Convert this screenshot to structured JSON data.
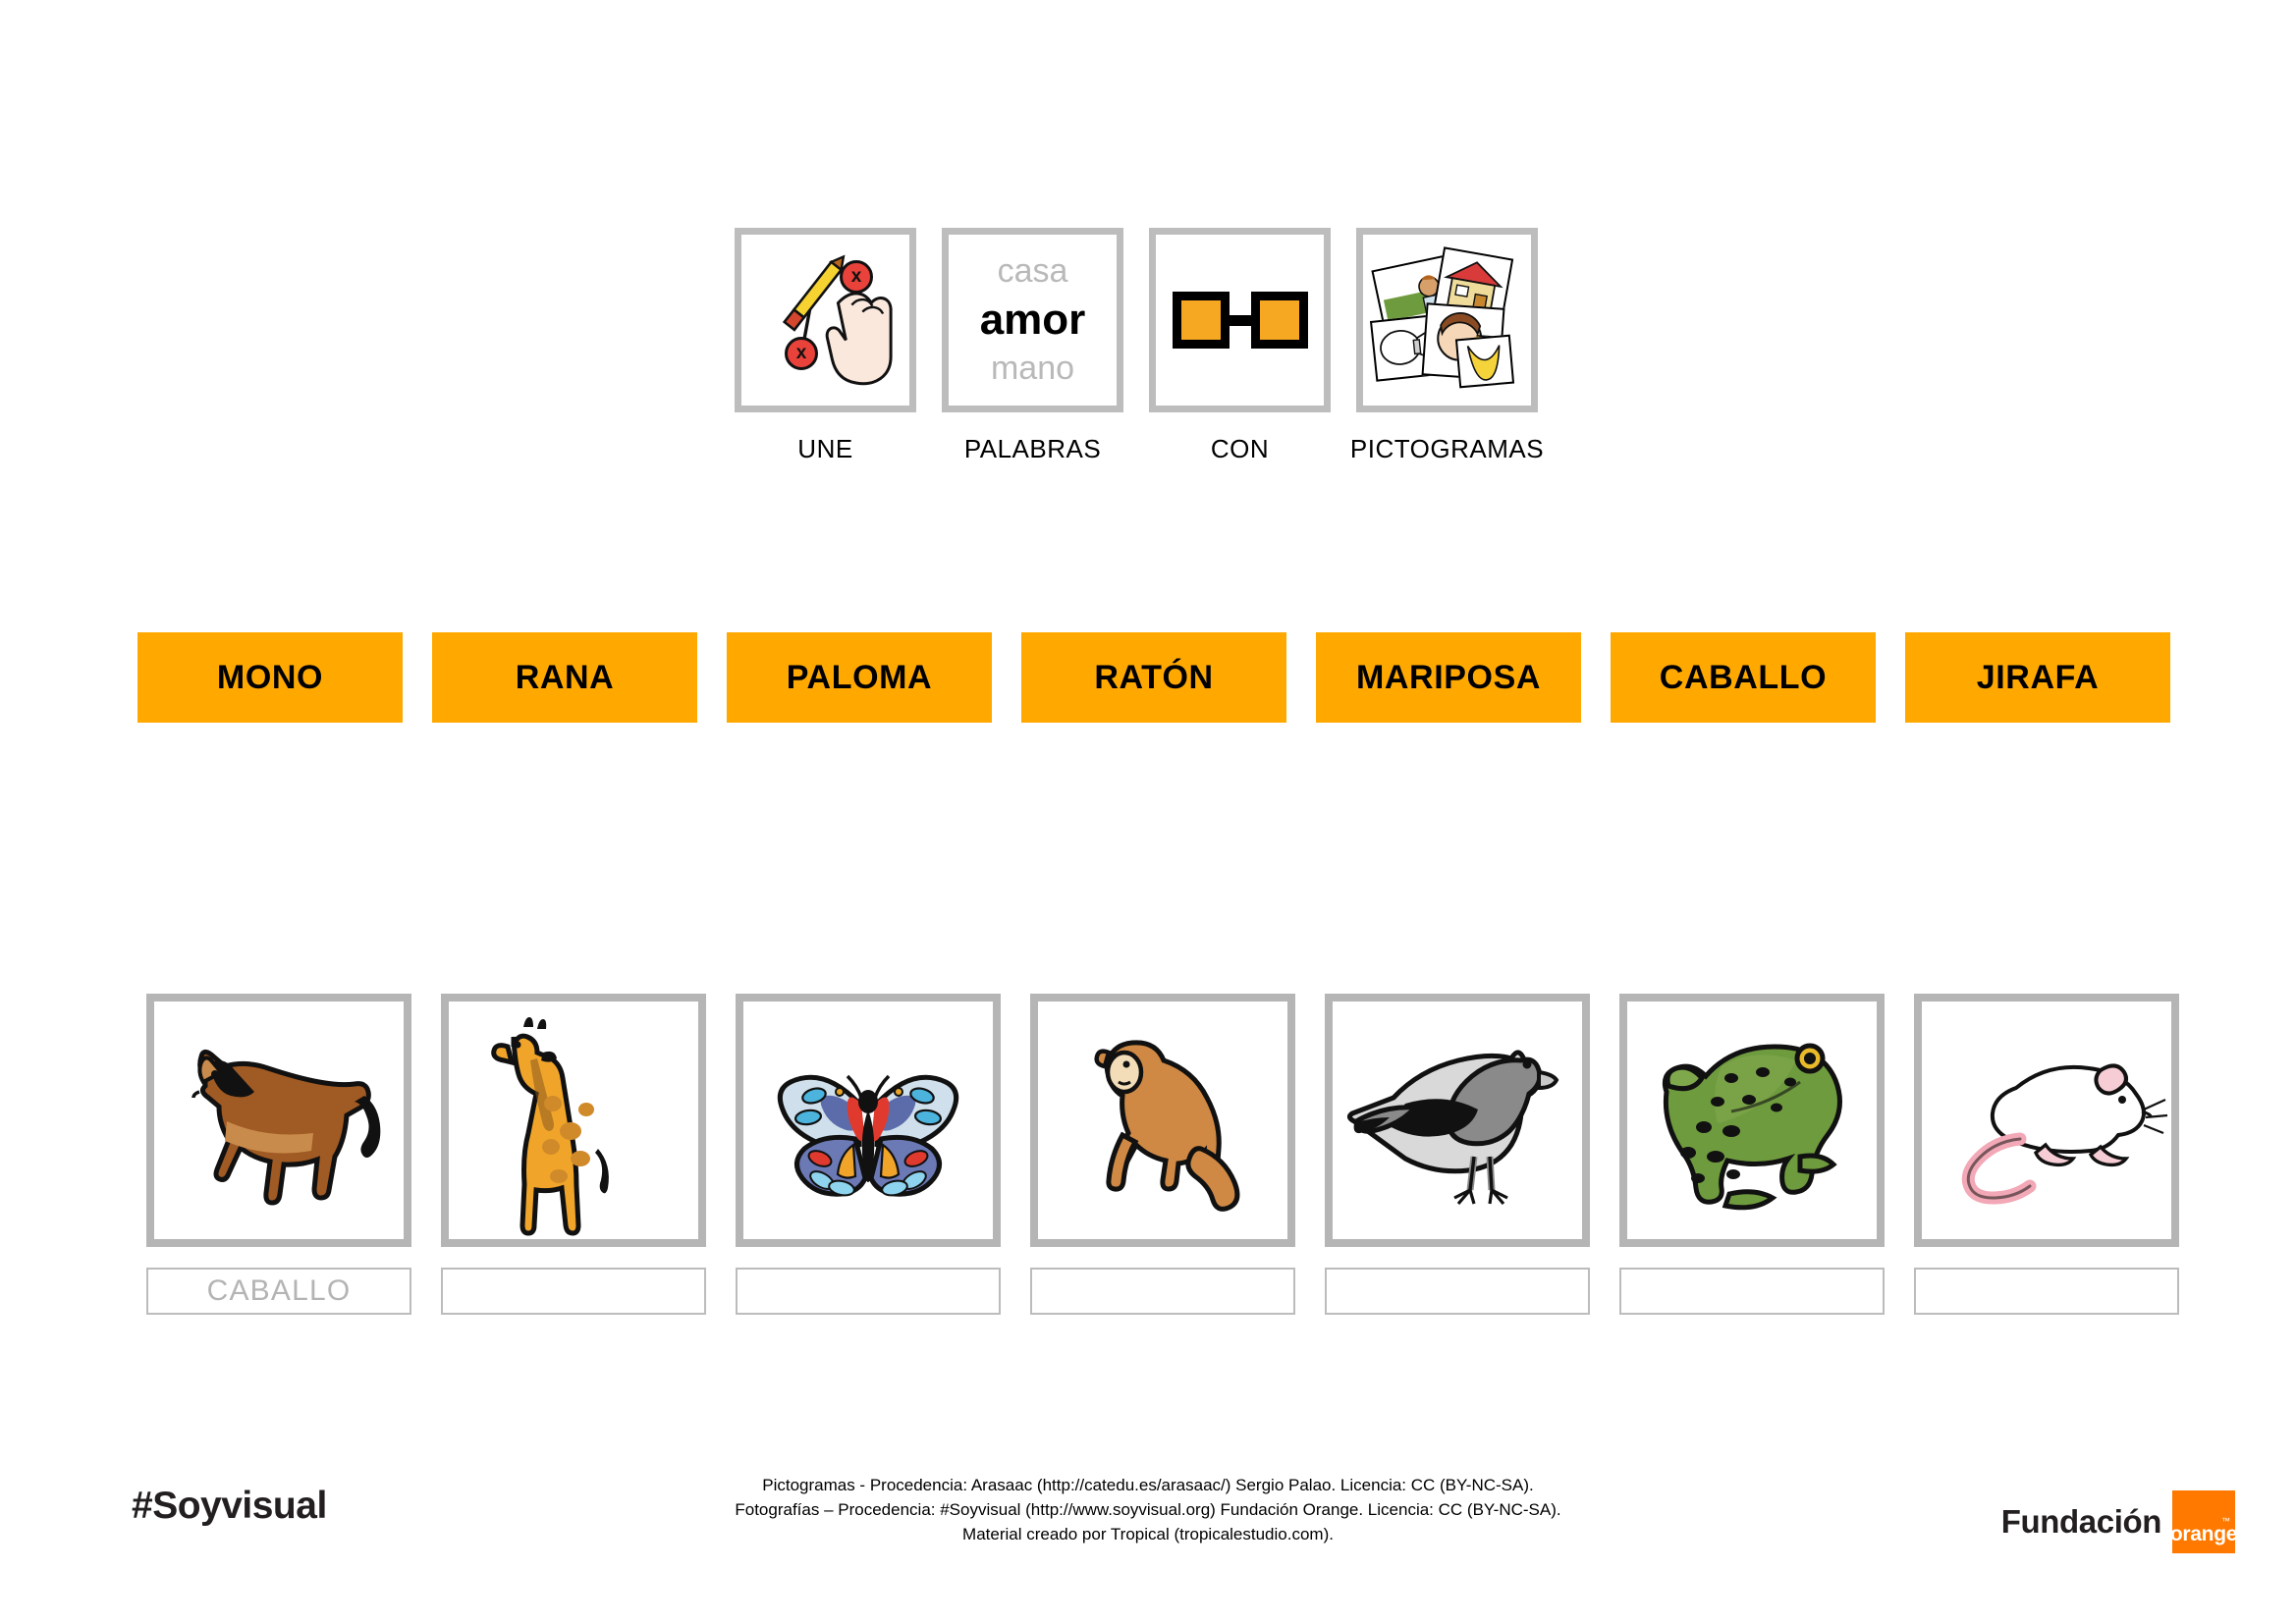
{
  "instruction": {
    "items": [
      {
        "label": "UNE",
        "icon": "hand-pencil-connect-icon"
      },
      {
        "label": "PALABRAS",
        "icon": "words-list-icon",
        "word_top": "casa",
        "word_middle": "amor",
        "word_bottom": "mano"
      },
      {
        "label": "CON",
        "icon": "link-squares-icon"
      },
      {
        "label": "PICTOGRAMAS",
        "icon": "pictogram-cards-icon"
      }
    ]
  },
  "word_bank": {
    "words": [
      "MONO",
      "RANA",
      "PALOMA",
      "RATÓN",
      "MARIPOSA",
      "CABALLO",
      "JIRAFA"
    ]
  },
  "pictograms": {
    "items": [
      {
        "icon": "horse-icon",
        "answer": "CABALLO"
      },
      {
        "icon": "giraffe-icon",
        "answer": ""
      },
      {
        "icon": "butterfly-icon",
        "answer": ""
      },
      {
        "icon": "monkey-icon",
        "answer": ""
      },
      {
        "icon": "pigeon-icon",
        "answer": ""
      },
      {
        "icon": "frog-icon",
        "answer": ""
      },
      {
        "icon": "mouse-icon",
        "answer": ""
      }
    ]
  },
  "footer": {
    "logo_left": "#Soyvisual",
    "credits_line1": "Pictogramas - Procedencia: Arasaac (http://catedu.es/arasaac/) Sergio Palao. Licencia: CC (BY-NC-SA).",
    "credits_line2": "Fotografías – Procedencia: #Soyvisual (http://www.soyvisual.org) Fundación Orange. Licencia: CC (BY-NC-SA).",
    "credits_line3": "Material creado por Tropical (tropicalestudio.com).",
    "logo_right_word": "Fundación",
    "logo_right_brand": "orange",
    "logo_right_tm": "™"
  },
  "colors": {
    "word_box_orange": "#ffa900",
    "frame_grey": "#b5b5b5",
    "placeholder_grey": "#b4b4b4",
    "brand_orange": "#ff7900"
  }
}
